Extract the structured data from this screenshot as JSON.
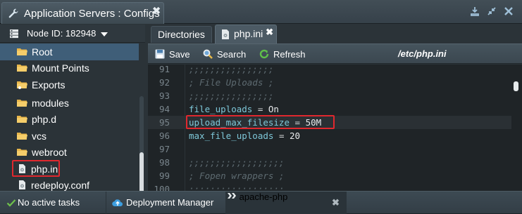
{
  "window": {
    "title": "Application Servers : Configs",
    "close_glyph": "✖",
    "controls": [
      {
        "name": "download-icon",
        "glyph": "⭳"
      },
      {
        "name": "collapse-icon",
        "glyph": "⤡"
      },
      {
        "name": "close-window-icon",
        "glyph": "✖"
      }
    ]
  },
  "sidebar": {
    "node_label": "Node ID: 182948",
    "items": [
      {
        "label": "Root",
        "type": "folder",
        "selected": true
      },
      {
        "label": "Mount Points",
        "type": "folder"
      },
      {
        "label": "Exports",
        "type": "folder-share"
      },
      {
        "label": "modules",
        "type": "folder"
      },
      {
        "label": "php.d",
        "type": "folder"
      },
      {
        "label": "vcs",
        "type": "folder"
      },
      {
        "label": "webroot",
        "type": "folder"
      },
      {
        "label": "php.ini",
        "type": "file",
        "highlighted": true
      },
      {
        "label": "redeploy.conf",
        "type": "file"
      }
    ]
  },
  "tabs": [
    {
      "label": "Directories"
    },
    {
      "label": "php.ini",
      "close_glyph": "✖"
    }
  ],
  "toolbar": {
    "save_label": "Save",
    "search_label": "Search",
    "refresh_label": "Refresh",
    "file_path": "/etc/php.ini"
  },
  "editor": {
    "lines": [
      {
        "num": "91",
        "kind": "comment",
        "text": ";;;;;;;;;;;;;;;;"
      },
      {
        "num": "92",
        "kind": "comment",
        "text": "; File Uploads ;"
      },
      {
        "num": "93",
        "kind": "comment",
        "text": ";;;;;;;;;;;;;;;;"
      },
      {
        "num": "94",
        "kind": "setting",
        "key": "file_uploads",
        "eq": " = ",
        "value": "On"
      },
      {
        "num": "95",
        "kind": "setting",
        "key": "upload_max_filesize",
        "eq": " = ",
        "value": "50M",
        "current": true,
        "highlighted": true
      },
      {
        "num": "96",
        "kind": "setting",
        "key": "max_file_uploads",
        "eq": " = ",
        "value": "20"
      },
      {
        "num": "97",
        "kind": "blank",
        "text": ""
      },
      {
        "num": "98",
        "kind": "comment",
        "text": ";;;;;;;;;;;;;;;;;;"
      },
      {
        "num": "99",
        "kind": "comment",
        "text": "; Fopen wrappers ;"
      },
      {
        "num": "100",
        "kind": "comment",
        "text": ";;;;;;;;;;;;;;;;;;"
      }
    ]
  },
  "statusbar": {
    "tasks_label": "No active tasks",
    "deployment_label": "Deployment Manager",
    "env_label": "apache-php",
    "close_glyph": "✖"
  },
  "colors": {
    "accent_red": "#e0282e",
    "selected_row": "#3f5e78",
    "folder": "#e8b64a",
    "check_green": "#6fc24b",
    "cloud_blue": "#3d9ee0"
  }
}
